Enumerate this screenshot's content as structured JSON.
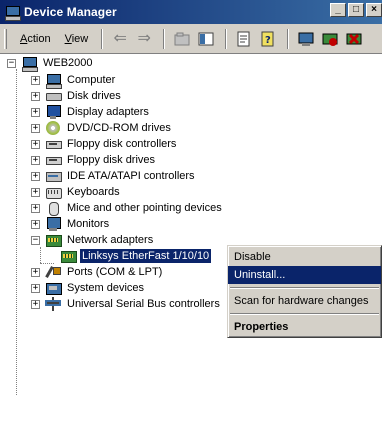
{
  "window": {
    "title": "Device Manager",
    "buttons": [
      "_",
      "□",
      "×"
    ]
  },
  "menu": {
    "action": {
      "underline": "A",
      "rest": "ction"
    },
    "view": {
      "underline": "V",
      "rest": "iew"
    }
  },
  "toolbar_icons": [
    "back-arrow-icon",
    "forward-arrow-icon",
    "up-folder-icon",
    "show-hide-tree-icon",
    "properties-icon",
    "help-icon",
    "scan-hardware-icon",
    "disable-device-icon",
    "uninstall-device-icon"
  ],
  "tree": {
    "root": "WEB2000",
    "items": [
      {
        "label": "Computer",
        "icon": "computer-icon",
        "expander": "+"
      },
      {
        "label": "Disk drives",
        "icon": "disk-drive-icon",
        "expander": "+"
      },
      {
        "label": "Display adapters",
        "icon": "display-adapter-icon",
        "expander": "+"
      },
      {
        "label": "DVD/CD-ROM drives",
        "icon": "dvd-drive-icon",
        "expander": "+"
      },
      {
        "label": "Floppy disk controllers",
        "icon": "floppy-controller-icon",
        "expander": "+"
      },
      {
        "label": "Floppy disk drives",
        "icon": "floppy-drive-icon",
        "expander": "+"
      },
      {
        "label": "IDE ATA/ATAPI controllers",
        "icon": "ide-controller-icon",
        "expander": "+"
      },
      {
        "label": "Keyboards",
        "icon": "keyboard-icon",
        "expander": "+"
      },
      {
        "label": "Mice and other pointing devices",
        "icon": "mouse-icon",
        "expander": "+"
      },
      {
        "label": "Monitors",
        "icon": "monitor-icon",
        "expander": "+"
      },
      {
        "label": "Network adapters",
        "icon": "network-adapter-icon",
        "expander": "−"
      },
      {
        "label": "Ports (COM & LPT)",
        "icon": "ports-icon",
        "expander": "+"
      },
      {
        "label": "System devices",
        "icon": "system-devices-icon",
        "expander": "+"
      },
      {
        "label": "Universal Serial Bus controllers",
        "icon": "usb-icon",
        "expander": "+"
      }
    ],
    "selected_child": "Linksys EtherFast 1/10/10"
  },
  "context_menu": {
    "items": [
      "Disable",
      "Uninstall...",
      "Scan for hardware changes",
      "Properties"
    ],
    "highlighted": "Uninstall..."
  },
  "colors": {
    "title_bar": "#0a246a",
    "selection": "#0a246a",
    "face": "#d4d0c8"
  }
}
